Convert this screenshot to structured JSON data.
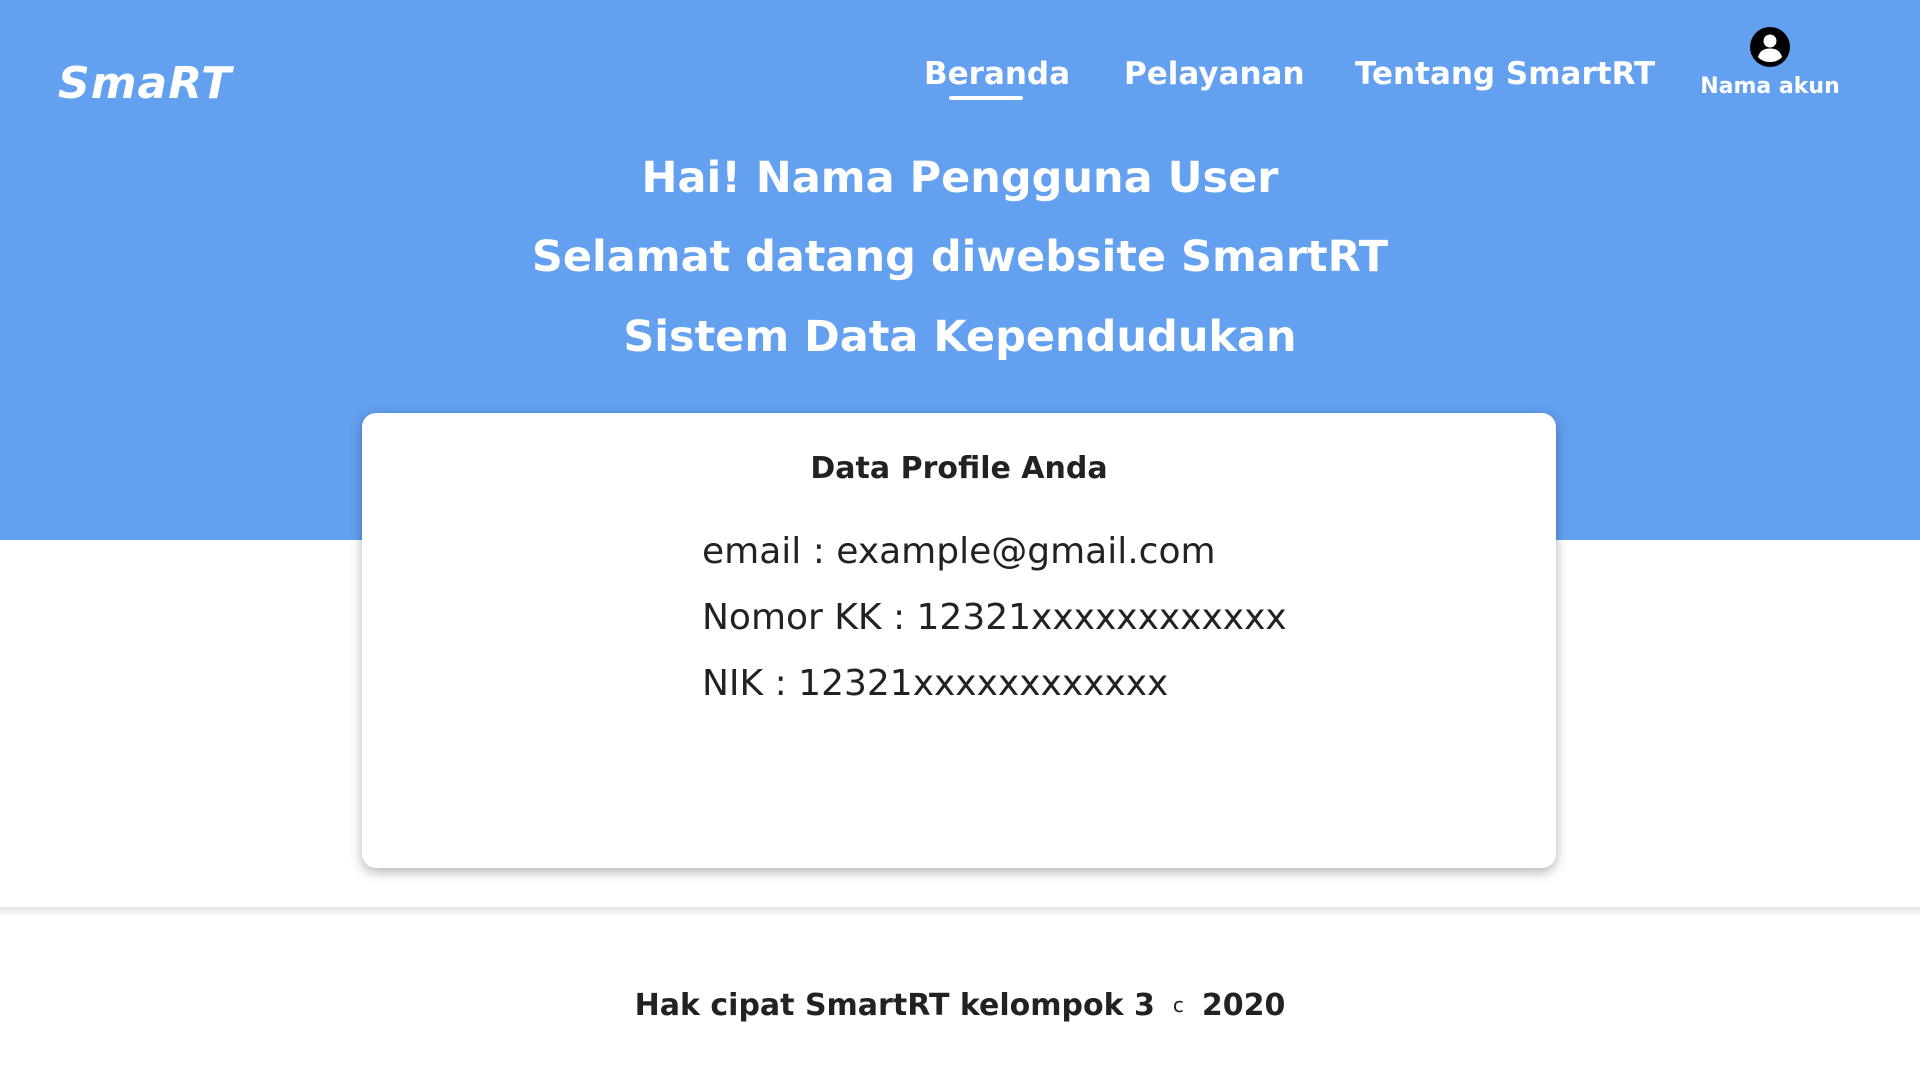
{
  "brand": {
    "logo": "SmaRT"
  },
  "nav": {
    "items": [
      {
        "label": "Beranda",
        "active": true
      },
      {
        "label": "Pelayanan",
        "active": false
      },
      {
        "label": "Tentang SmartRT",
        "active": false
      }
    ],
    "account": {
      "label": "Nama akun",
      "icon": "user-circle-icon"
    }
  },
  "hero": {
    "line1": "Hai! Nama Pengguna User",
    "line2": "Selamat datang diwebsite SmartRT",
    "line3": "Sistem Data Kependudukan"
  },
  "profile": {
    "title": "Data Profile Anda",
    "email": "email : example@gmail.com",
    "kk": "Nomor KK : 12321xxxxxxxxxxxx",
    "nik": "NIK : 12321xxxxxxxxxxxx"
  },
  "footer": {
    "text": "Hak cipat SmartRT kelompok 3",
    "symbol": "c",
    "year": "2020"
  },
  "colors": {
    "hero_bg": "#63a0f0",
    "text_light": "#ffffff",
    "text_dark": "#222222"
  }
}
